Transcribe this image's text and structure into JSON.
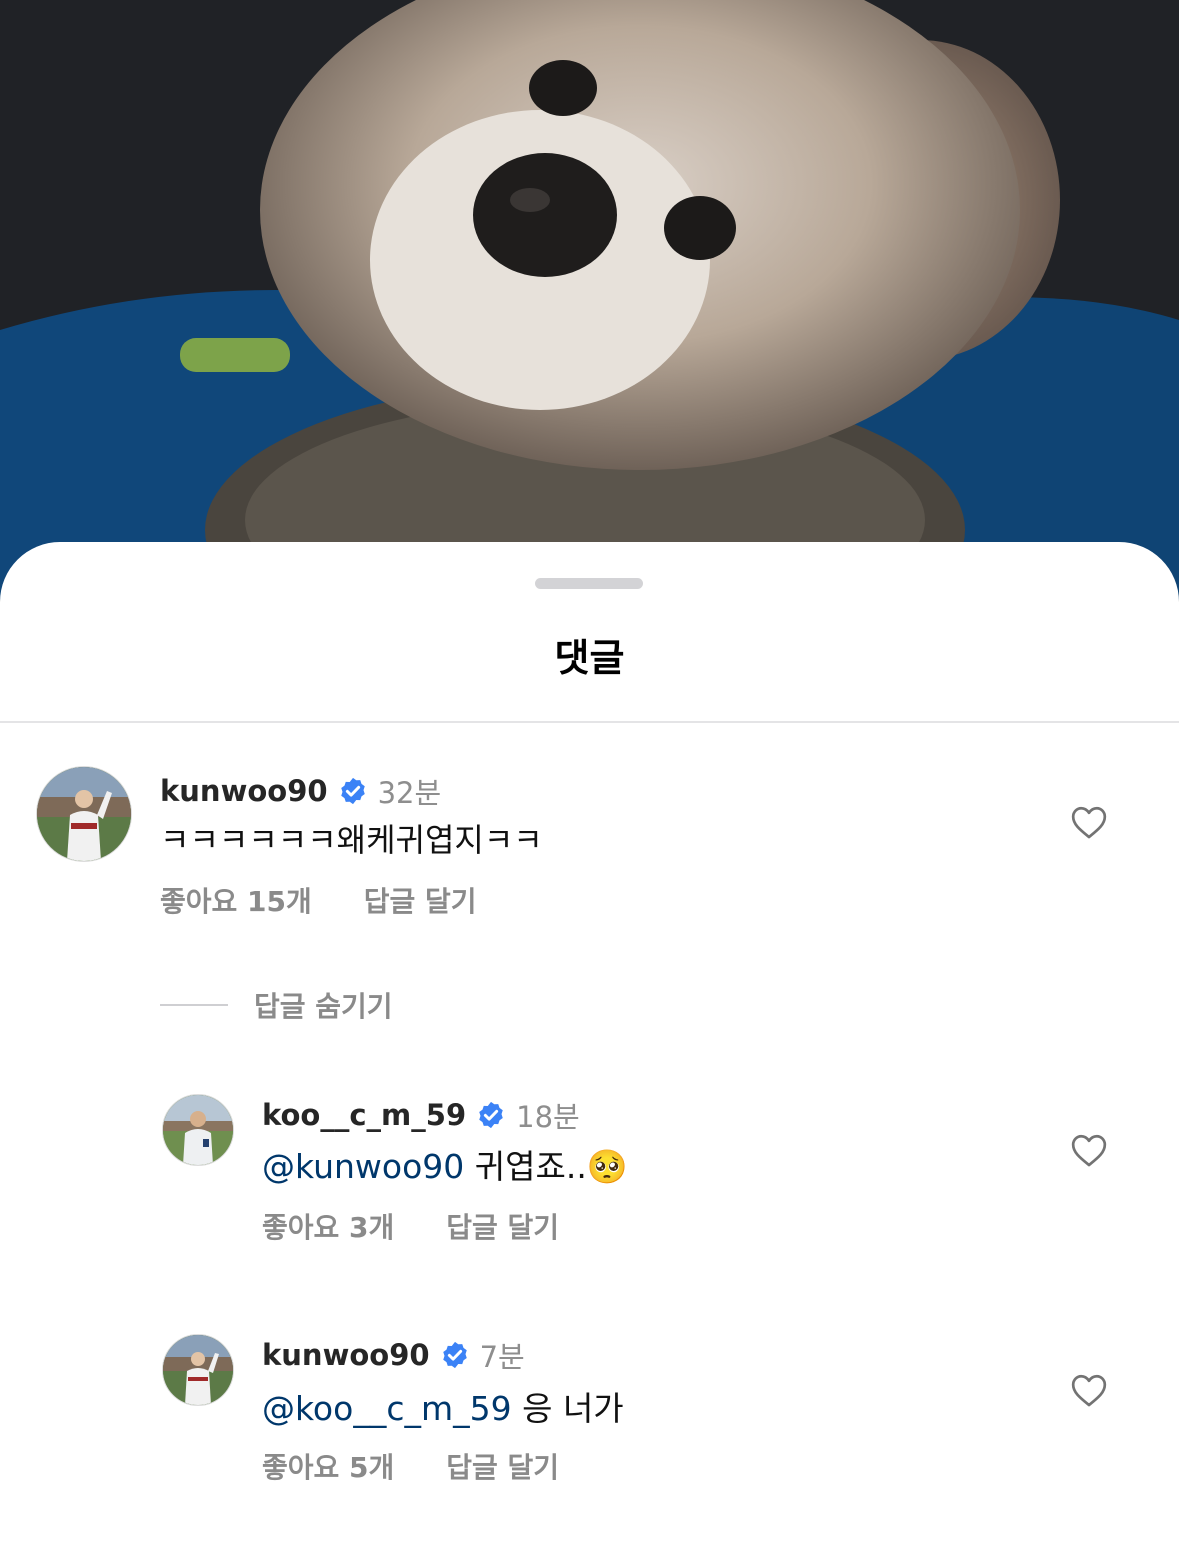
{
  "video": {
    "subject": "fluffy-dog-in-blue-bed"
  },
  "sheet": {
    "title": "댓글"
  },
  "comments": [
    {
      "username": "kunwoo90",
      "verified": true,
      "time": "32분",
      "mention": "",
      "text": "ㅋㅋㅋㅋㅋㅋ왜케귀엽지ㅋㅋ",
      "likes": "좋아요 15개",
      "reply_label": "답글 달기"
    },
    {
      "username": "koo__c_m_59",
      "verified": true,
      "time": "18분",
      "mention": "@kunwoo90",
      "text": " 귀엽죠..🥺",
      "likes": "좋아요 3개",
      "reply_label": "답글 달기"
    },
    {
      "username": "kunwoo90",
      "verified": true,
      "time": "7분",
      "mention": "@koo__c_m_59",
      "text": " 응 너가",
      "likes": "좋아요 5개",
      "reply_label": "답글 달기"
    }
  ],
  "hide_replies_label": "답글 숨기기",
  "colors": {
    "verified": "#3b82f6",
    "mention": "#00376b",
    "secondary_text": "#8e8e8e"
  },
  "icons": {
    "verified": "verified-badge-icon",
    "like": "heart-outline-icon"
  }
}
